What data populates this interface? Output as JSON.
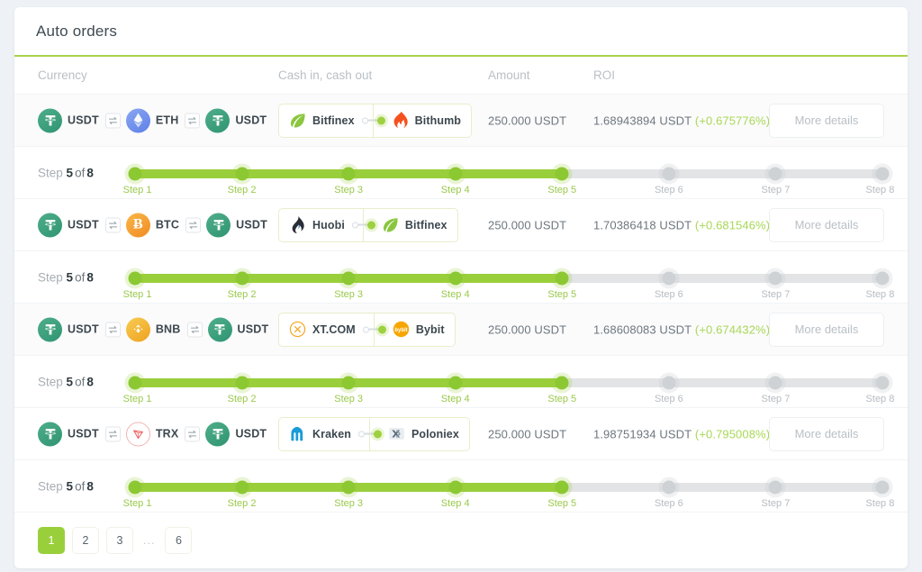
{
  "header": {
    "title": "Auto orders"
  },
  "columns": {
    "currency": "Currency",
    "cash": "Cash in, cash out",
    "amount": "Amount",
    "roi": "ROI"
  },
  "details_label": "More details",
  "step_word": "Step",
  "of_word": "of",
  "colors": {
    "accent": "#9acf3c",
    "accent_dark": "#8cc832",
    "track": "#e2e4e6",
    "roi_positive": "#a8d856",
    "header_rule": "#a9d24b"
  },
  "orders": [
    {
      "tinted": true,
      "chain": [
        {
          "symbol": "USDT",
          "icon": "usdt-coin-icon"
        },
        {
          "symbol": "ETH",
          "icon": "eth-coin-icon"
        },
        {
          "symbol": "USDT",
          "icon": "usdt-coin-icon"
        }
      ],
      "cash_in": {
        "name": "Bitfinex",
        "icon": "bitfinex-logo-icon"
      },
      "cash_out": {
        "name": "Bithumb",
        "icon": "bithumb-logo-icon"
      },
      "amount": "250.000 USDT",
      "roi_value": "1.68943894 USDT",
      "roi_percent": "(+0.675776%)",
      "step_current": "5",
      "step_total": "8",
      "steps": [
        {
          "label": "Step 1",
          "done": true
        },
        {
          "label": "Step 2",
          "done": true
        },
        {
          "label": "Step 3",
          "done": true
        },
        {
          "label": "Step 4",
          "done": true
        },
        {
          "label": "Step 5",
          "done": true
        },
        {
          "label": "Step 6",
          "done": false
        },
        {
          "label": "Step 7",
          "done": false
        },
        {
          "label": "Step 8",
          "done": false
        }
      ]
    },
    {
      "tinted": false,
      "chain": [
        {
          "symbol": "USDT",
          "icon": "usdt-coin-icon"
        },
        {
          "symbol": "BTC",
          "icon": "btc-coin-icon"
        },
        {
          "symbol": "USDT",
          "icon": "usdt-coin-icon"
        }
      ],
      "cash_in": {
        "name": "Huobi",
        "icon": "huobi-logo-icon"
      },
      "cash_out": {
        "name": "Bitfinex",
        "icon": "bitfinex-logo-icon"
      },
      "amount": "250.000 USDT",
      "roi_value": "1.70386418 USDT",
      "roi_percent": "(+0.681546%)",
      "step_current": "5",
      "step_total": "8",
      "steps": [
        {
          "label": "Step 1",
          "done": true
        },
        {
          "label": "Step 2",
          "done": true
        },
        {
          "label": "Step 3",
          "done": true
        },
        {
          "label": "Step 4",
          "done": true
        },
        {
          "label": "Step 5",
          "done": true
        },
        {
          "label": "Step 6",
          "done": false
        },
        {
          "label": "Step 7",
          "done": false
        },
        {
          "label": "Step 8",
          "done": false
        }
      ]
    },
    {
      "tinted": true,
      "chain": [
        {
          "symbol": "USDT",
          "icon": "usdt-coin-icon"
        },
        {
          "symbol": "BNB",
          "icon": "bnb-coin-icon"
        },
        {
          "symbol": "USDT",
          "icon": "usdt-coin-icon"
        }
      ],
      "cash_in": {
        "name": "XT.COM",
        "icon": "xtcom-logo-icon"
      },
      "cash_out": {
        "name": "Bybit",
        "icon": "bybit-logo-icon"
      },
      "amount": "250.000 USDT",
      "roi_value": "1.68608083 USDT",
      "roi_percent": "(+0.674432%)",
      "step_current": "5",
      "step_total": "8",
      "steps": [
        {
          "label": "Step 1",
          "done": true
        },
        {
          "label": "Step 2",
          "done": true
        },
        {
          "label": "Step 3",
          "done": true
        },
        {
          "label": "Step 4",
          "done": true
        },
        {
          "label": "Step 5",
          "done": true
        },
        {
          "label": "Step 6",
          "done": false
        },
        {
          "label": "Step 7",
          "done": false
        },
        {
          "label": "Step 8",
          "done": false
        }
      ]
    },
    {
      "tinted": false,
      "chain": [
        {
          "symbol": "USDT",
          "icon": "usdt-coin-icon"
        },
        {
          "symbol": "TRX",
          "icon": "trx-coin-icon"
        },
        {
          "symbol": "USDT",
          "icon": "usdt-coin-icon"
        }
      ],
      "cash_in": {
        "name": "Kraken",
        "icon": "kraken-logo-icon"
      },
      "cash_out": {
        "name": "Poloniex",
        "icon": "poloniex-logo-icon"
      },
      "amount": "250.000 USDT",
      "roi_value": "1.98751934 USDT",
      "roi_percent": "(+0.795008%)",
      "step_current": "5",
      "step_total": "8",
      "steps": [
        {
          "label": "Step 1",
          "done": true
        },
        {
          "label": "Step 2",
          "done": true
        },
        {
          "label": "Step 3",
          "done": true
        },
        {
          "label": "Step 4",
          "done": true
        },
        {
          "label": "Step 5",
          "done": true
        },
        {
          "label": "Step 6",
          "done": false
        },
        {
          "label": "Step 7",
          "done": false
        },
        {
          "label": "Step 8",
          "done": false
        }
      ]
    }
  ],
  "pagination": {
    "pages": [
      "1",
      "2",
      "3"
    ],
    "ellipsis": "...",
    "last": "6",
    "active": "1"
  }
}
